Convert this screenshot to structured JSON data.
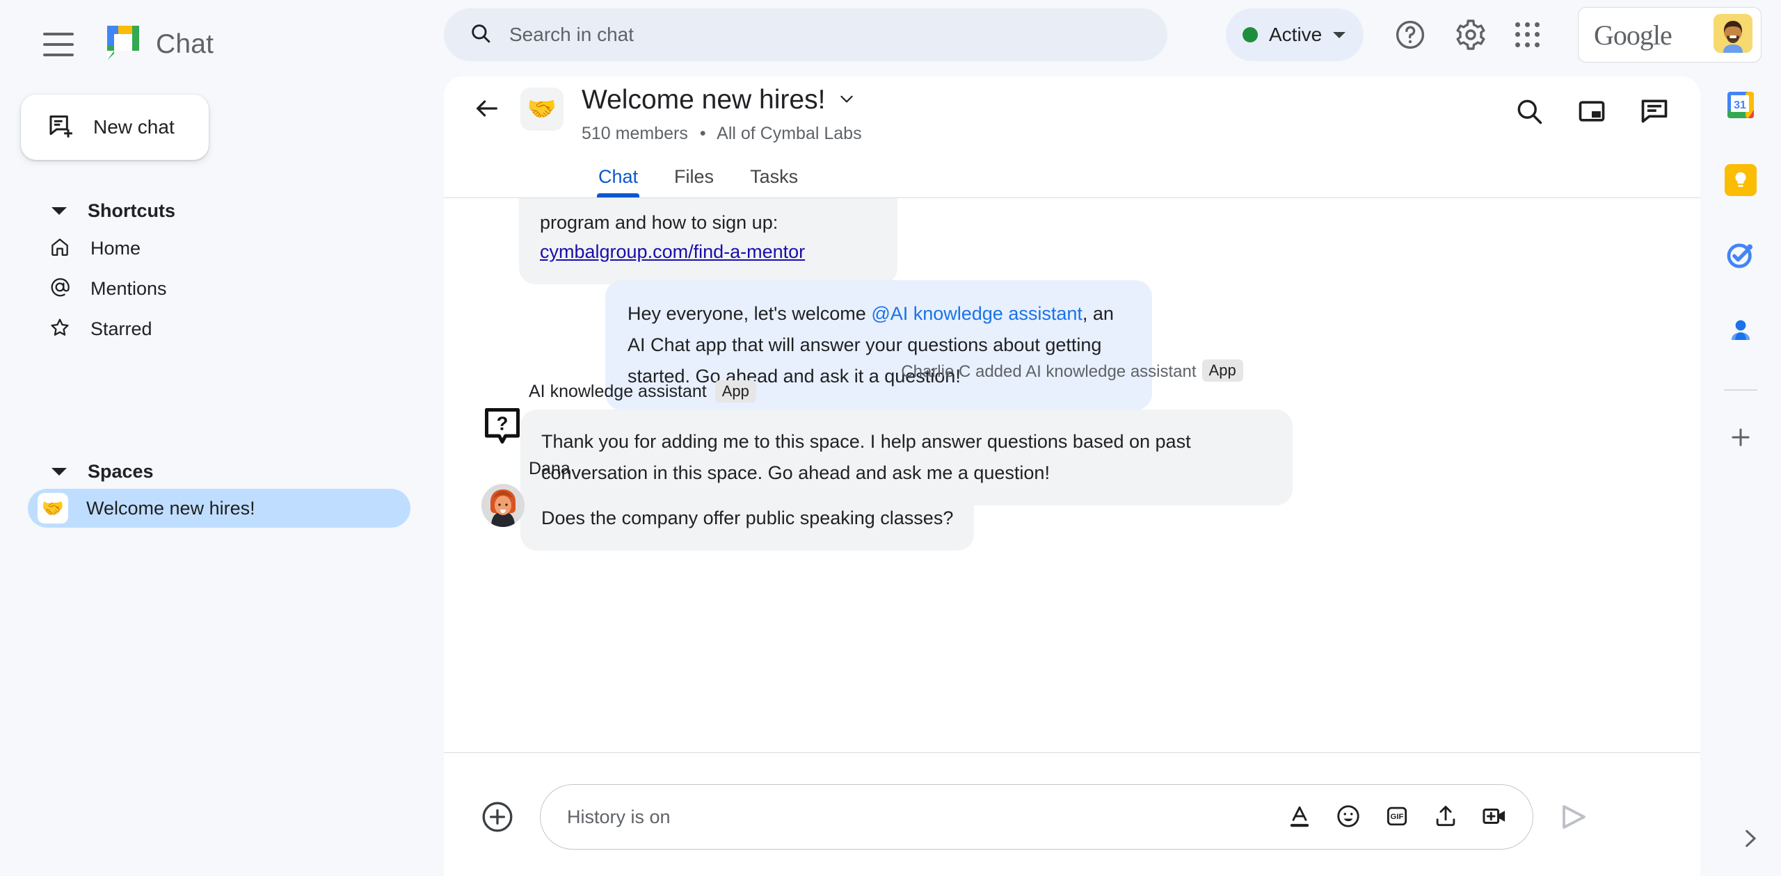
{
  "topbar": {
    "menu_icon": "hamburger-menu-icon",
    "logo_icon": "google-chat-logo",
    "app_title": "Chat",
    "search": {
      "placeholder": "Search in chat",
      "value": "",
      "icon": "search-icon"
    },
    "status": {
      "label": "Active",
      "color": "#1e8e3e",
      "chevron": "chevron-down-icon"
    },
    "help_icon": "help-circle-icon",
    "settings_icon": "gear-icon",
    "apps_icon": "apps-grid-icon",
    "account": {
      "brand": "Google",
      "avatar_icon": "user-avatar"
    }
  },
  "sidebar": {
    "new_chat": {
      "label": "New chat",
      "icon": "new-chat-icon"
    },
    "shortcuts_header": "Shortcuts",
    "shortcuts": [
      {
        "label": "Home",
        "icon": "home-icon"
      },
      {
        "label": "Mentions",
        "icon": "at-sign-icon"
      },
      {
        "label": "Starred",
        "icon": "star-icon"
      }
    ],
    "spaces_header": "Spaces",
    "spaces": [
      {
        "label": "Welcome new hires!",
        "emoji": "🤝",
        "active": true
      }
    ]
  },
  "space": {
    "back_icon": "back-arrow-icon",
    "emoji": "🤝",
    "title": "Welcome new hires!",
    "title_chevron": "chevron-down-icon",
    "members": "510 members",
    "separator": "•",
    "org": "All of Cymbal Labs",
    "header_actions": [
      {
        "icon": "search-icon"
      },
      {
        "icon": "picture-in-picture-icon"
      },
      {
        "icon": "open-chat-thread-icon"
      }
    ],
    "tabs": [
      {
        "label": "Chat",
        "active": true
      },
      {
        "label": "Files",
        "active": false
      },
      {
        "label": "Tasks",
        "active": false
      }
    ]
  },
  "messages": {
    "clipped": {
      "line1": "program and how to sign up:",
      "link": "cymbalgroup.com/find-a-mentor"
    },
    "welcome": {
      "prefix": "Hey everyone, let's welcome ",
      "mention": "@AI knowledge assistant",
      "suffix": ", an AI Chat app that will answer your questions about getting started.  Go ahead and ask it a question!"
    },
    "system": {
      "text": "Charlie C added AI knowledge assistant",
      "badge": "App"
    },
    "items": [
      {
        "sender": "AI knowledge assistant",
        "badge": "App",
        "avatar_icon": "question-bubble-icon",
        "text": "Thank you for adding me to this space. I help answer questions based on past conversation in this space. Go ahead and ask me a question!"
      },
      {
        "sender": "Dana",
        "badge": "",
        "avatar_icon": "user-avatar-dana",
        "text": "Does the company offer public speaking classes?"
      }
    ]
  },
  "compose": {
    "add_icon": "plus-circle-icon",
    "placeholder": "History is on",
    "value": "",
    "tools": [
      {
        "icon": "format-text-icon"
      },
      {
        "icon": "emoji-icon"
      },
      {
        "icon": "gif-icon"
      },
      {
        "icon": "upload-file-icon"
      },
      {
        "icon": "add-video-meeting-icon"
      }
    ],
    "send_icon": "send-icon"
  },
  "rail": {
    "items": [
      {
        "icon": "google-calendar-icon",
        "day": "31"
      },
      {
        "icon": "google-keep-icon"
      },
      {
        "icon": "google-tasks-icon"
      },
      {
        "icon": "google-contacts-icon"
      }
    ],
    "add_icon": "plus-icon",
    "expand_icon": "chevron-right-icon"
  },
  "colors": {
    "page_bg": "#f6f8fc",
    "panel_bg": "#ffffff",
    "accent_blue": "#0b57d0",
    "mention_blue": "#1a73e8",
    "link_blue": "#1a0dab",
    "bubble_gray": "#f1f3f4",
    "bubble_blue": "#e8f0fe",
    "space_active": "#bfdeff",
    "search_bg": "#e9eef6",
    "status_green": "#1e8e3e"
  }
}
